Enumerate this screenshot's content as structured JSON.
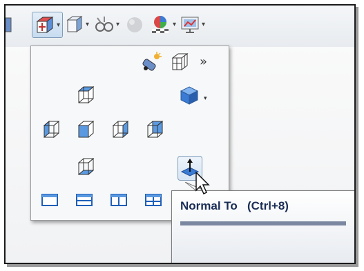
{
  "tooltip": {
    "title": "Normal To",
    "shortcut": "(Ctrl+8)"
  },
  "toolbar": {
    "items": [
      "partial-icon",
      "view-orientation-icon",
      "display-style-icon",
      "hide-show-icon",
      "edit-appearance-icon",
      "apply-scene-icon",
      "view-settings-icon"
    ]
  },
  "popup": {
    "top_row": [
      "new-view-icon",
      "view-selector-icon",
      "more-icon"
    ],
    "views": [
      "top-view",
      "front-view",
      "left-view",
      "right-view",
      "back-view",
      "bottom-view",
      "isometric-view",
      "normal-to"
    ],
    "layouts": [
      "single-view",
      "two-view-horizontal",
      "two-view-vertical",
      "four-view"
    ]
  },
  "colors": {
    "accent": "#3a7bd5",
    "tooltip_text": "#1b2d55"
  }
}
